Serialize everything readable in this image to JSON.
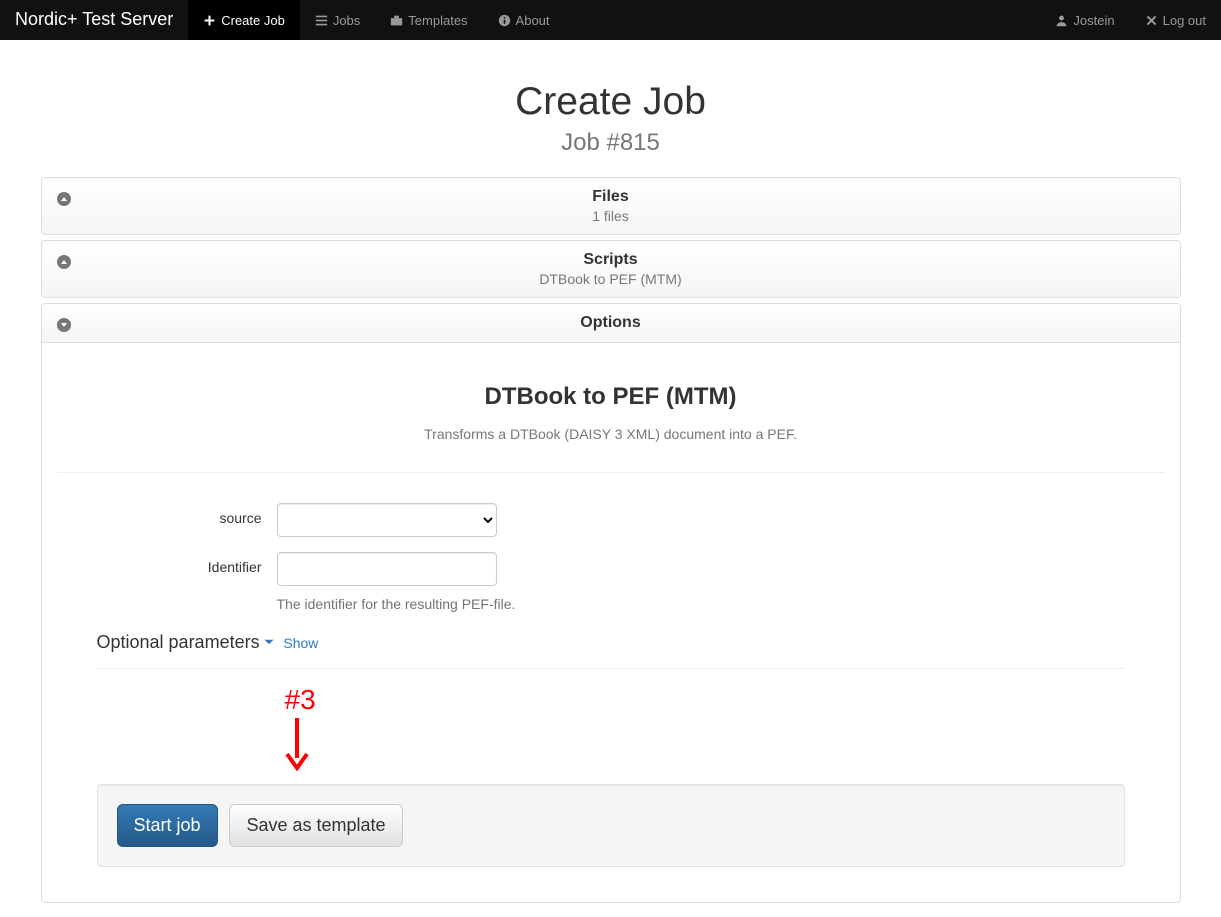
{
  "navbar": {
    "brand": "Nordic+ Test Server",
    "items": [
      {
        "label": "Create Job",
        "icon": "plus"
      },
      {
        "label": "Jobs",
        "icon": "list"
      },
      {
        "label": "Templates",
        "icon": "briefcase"
      },
      {
        "label": "About",
        "icon": "info"
      }
    ],
    "user": "Jostein",
    "logout": "Log out"
  },
  "header": {
    "title": "Create Job",
    "subtitle": "Job #815"
  },
  "panels": {
    "files": {
      "title": "Files",
      "subtitle": "1 files"
    },
    "scripts": {
      "title": "Scripts",
      "subtitle": "DTBook to PEF (MTM)"
    },
    "options": {
      "title": "Options"
    }
  },
  "script": {
    "title": "DTBook to PEF (MTM)",
    "description": "Transforms a DTBook (DAISY 3 XML) document into a PEF."
  },
  "form": {
    "source_label": "source",
    "identifier_label": "Identifier",
    "identifier_help": "The identifier for the resulting PEF-file.",
    "optional_label": "Optional parameters",
    "show_label": "Show"
  },
  "annotation": {
    "label": "#3"
  },
  "buttons": {
    "start": "Start job",
    "save_template": "Save as template"
  }
}
